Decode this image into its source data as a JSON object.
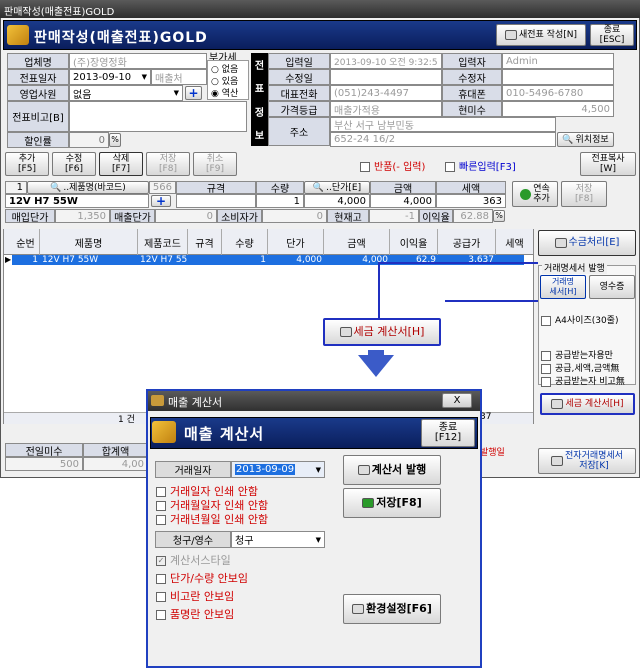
{
  "window": {
    "title": "판매작성(매출전표)GOLD"
  },
  "header": {
    "title": "판매작성(매출전표)GOLD",
    "new_invoice": "새전표 작성[N]",
    "close": "종료\n[ESC]"
  },
  "form": {
    "company_label": "업체명",
    "company_value": "(주)장영정화",
    "date_label": "전표일자",
    "date_value": "2013-09-10",
    "date_type": "매출처",
    "sales_label": "영업사원",
    "sales_value": "없음",
    "memo_label": "전표비고[B]",
    "discount_label": "할인률",
    "discount_value": "0",
    "vat_label": "부가세",
    "vat_options": [
      "없음",
      "있음",
      "역산"
    ],
    "vat_selected": "역산"
  },
  "invoice_info": {
    "vlabel": [
      "전",
      "표",
      "정",
      "보"
    ],
    "input_date_label": "입력일",
    "input_date_value": "2013-09-10 오전 9:32:5",
    "modify_date_label": "수정일",
    "phone_label": "대표전화",
    "phone_value": "(051)243-4497",
    "price_grade_label": "가격등급",
    "price_grade_value": "매출가적용",
    "address_label": "주소",
    "address_line1": "부산 서구 남부민동",
    "address_line2": "652-24 16/2",
    "inputter_label": "입력자",
    "inputter_value": "Admin",
    "modifier_label": "수정자",
    "mobile_label": "휴대폰",
    "mobile_value": "010-5496-6780",
    "unpaid_label": "현미수",
    "unpaid_value": "4,500",
    "location_button": "위치정보"
  },
  "toolbar": {
    "add": "추가\n[F5]",
    "edit": "수정\n[F6]",
    "delete": "삭제\n[F7]",
    "save": "저장\n[F8]",
    "cancel": "취소\n[F9]",
    "return_label": "반품(- 입력)",
    "quick_label": "빠른입력[F3]",
    "copy": "전표복사\n[W]"
  },
  "entry": {
    "no": "1",
    "product_label": "..제품명(바코드)",
    "product_value": "12V H7 55W",
    "count": "566",
    "spec_label": "규격",
    "qty_label": "수량",
    "qty_value": "1",
    "price_label": "..단가[E]",
    "price_value": "4,000",
    "amount_label": "금액",
    "amount_value": "4,000",
    "tax_label": "세액",
    "tax_value": "363",
    "continuous": "연속\n추가",
    "save2": "저장\n[F8]",
    "buy_label": "매입단가",
    "buy_value": "1,350",
    "sell_label": "매출단가",
    "sell_value": "0",
    "consumer_label": "소비자가",
    "consumer_value": "0",
    "stock_label": "현재고",
    "stock_value": "-1",
    "margin_label": "이익율",
    "margin_value": "62.88"
  },
  "table": {
    "headers": [
      "순번",
      "제품명",
      "제품코드",
      "규격",
      "수량",
      "단가",
      "금액",
      "이익율",
      "공급가",
      "세액"
    ],
    "row": [
      "1",
      "12V H7 55W",
      "12V H7 55",
      "",
      "1",
      "4,000",
      "4,000",
      "62.9",
      "3,637",
      ""
    ],
    "footer_count": "1 건",
    "footer_num": "37"
  },
  "right_panel": {
    "collect": "수금처리[E]",
    "group_title": "거래명세서 발행",
    "statement": "거래명\n세서[H]",
    "receipt": "영수증",
    "a4_label": "A4사이즈(30줄)",
    "opt1": "공급받는자용만",
    "opt2": "공급,세액,금액無",
    "opt3": "공급받는자 비고無",
    "tax_invoice": "세금 계산서[H]",
    "e_statement": "전자거래명세서\n저장[K]"
  },
  "callout": {
    "tax_invoice": "세금 계산서[H]"
  },
  "bottom": {
    "prev_unpaid_label": "전일미수",
    "prev_unpaid_value": "500",
    "total_label": "합계액",
    "total_value": "4,00",
    "red_text": "발행일"
  },
  "dialog": {
    "window_title": "매출 계산서",
    "heading": "매출 계산서",
    "close": "종료\n[F12]",
    "date_label": "거래일자",
    "date_value": "2013-09-09",
    "chk_day": "거래일자 인쇄 안함",
    "chk_month": "거래월일자 인쇄 안함",
    "chk_year": "거래년월일 인쇄 안함",
    "type_label": "청구/영수",
    "type_value": "청구",
    "style_label": "계산서스타일",
    "chk_qty": "단가/수량 안보임",
    "chk_memo": "비고란 안보임",
    "chk_item": "품명란 안보임",
    "issue": "계산서 발행",
    "save": "저장[F8]",
    "settings": "환경설정[F6]"
  }
}
